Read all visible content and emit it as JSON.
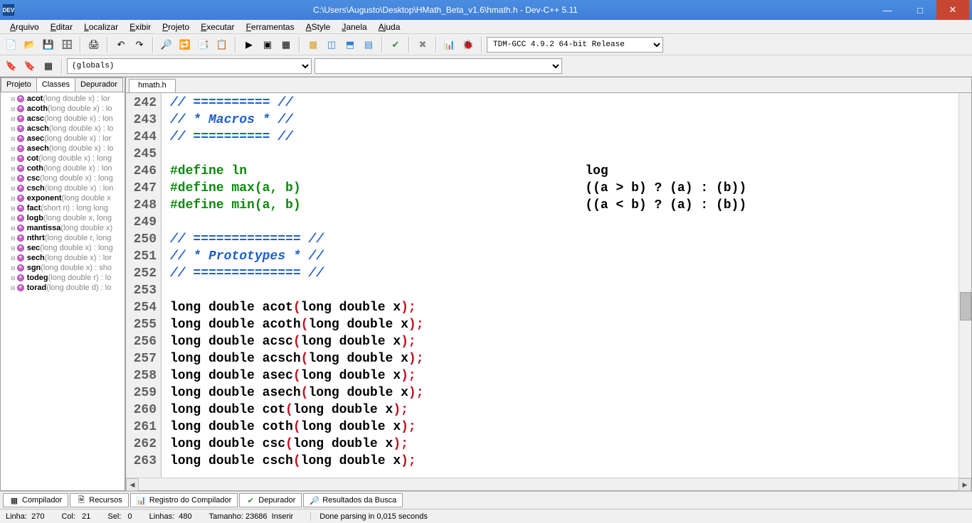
{
  "window": {
    "title": "C:\\Users\\Augusto\\Desktop\\HMath_Beta_v1.6\\hmath.h - Dev-C++ 5.11",
    "icon_label": "DEV"
  },
  "menu": [
    "Arquivo",
    "Editar",
    "Localizar",
    "Exibir",
    "Projeto",
    "Executar",
    "Ferramentas",
    "AStyle",
    "Janela",
    "Ajuda"
  ],
  "compiler_select": "TDM-GCC 4.9.2 64-bit Release",
  "scope_select": "(globals)",
  "sidebar_tabs": {
    "project": "Projeto",
    "classes": "Classes",
    "debug": "Depurador"
  },
  "classes": [
    {
      "fn": "acot",
      "sig": "(long double x) : lor"
    },
    {
      "fn": "acoth",
      "sig": "(long double x) : lo"
    },
    {
      "fn": "acsc",
      "sig": "(long double x) : lon"
    },
    {
      "fn": "acsch",
      "sig": "(long double x) : lo"
    },
    {
      "fn": "asec",
      "sig": "(long double x) : lor"
    },
    {
      "fn": "asech",
      "sig": "(long double x) : lo"
    },
    {
      "fn": "cot",
      "sig": "(long double x) : long"
    },
    {
      "fn": "coth",
      "sig": "(long double x) : lon"
    },
    {
      "fn": "csc",
      "sig": "(long double x) : long"
    },
    {
      "fn": "csch",
      "sig": "(long double x) : lon"
    },
    {
      "fn": "exponent",
      "sig": "(long double x"
    },
    {
      "fn": "fact",
      "sig": "(short n) : long long"
    },
    {
      "fn": "logb",
      "sig": "(long double x, long"
    },
    {
      "fn": "mantissa",
      "sig": "(long double x)"
    },
    {
      "fn": "nthrt",
      "sig": "(long double r, long"
    },
    {
      "fn": "sec",
      "sig": "(long double x) : long"
    },
    {
      "fn": "sech",
      "sig": "(long double x) : lor"
    },
    {
      "fn": "sgn",
      "sig": "(long double x) : sho"
    },
    {
      "fn": "todeg",
      "sig": "(long double r) : lo"
    },
    {
      "fn": "torad",
      "sig": "(long double d) : lo"
    }
  ],
  "file_tab": "hmath.h",
  "gutter_lines": [
    "242",
    "243",
    "244",
    "245",
    "246",
    "247",
    "248",
    "249",
    "250",
    "251",
    "252",
    "253",
    "254",
    "255",
    "256",
    "257",
    "258",
    "259",
    "260",
    "261",
    "262",
    "263"
  ],
  "code": {
    "l242": "// ========== //",
    "l243": "// * Macros * //",
    "l244": "// ========== //",
    "l246a": "#define ln",
    "l246b": "log",
    "l247a": "#define max(a, b)",
    "l247b": "((a > b) ? (a) : (b))",
    "l248a": "#define min(a, b)",
    "l248b": "((a < b) ? (a) : (b))",
    "l250": "// ============== //",
    "l251": "// * Prototypes * //",
    "l252": "// ============== //",
    "proto": [
      "acot",
      "acoth",
      "acsc",
      "acsch",
      "asec",
      "asech",
      "cot",
      "coth",
      "csc",
      "csch"
    ]
  },
  "bottom_tabs": {
    "compiler": "Compilador",
    "resources": "Recursos",
    "comp_log": "Registro do Compilador",
    "debugger": "Depurador",
    "search": "Resultados da Busca"
  },
  "status": {
    "line": "Linha:  270",
    "col": "Col:   21",
    "sel": "Sel:   0",
    "lines": "Linhas:  480",
    "size": "Tamanho: 23686  Inserir",
    "parse": "Done parsing in 0,015 seconds"
  }
}
